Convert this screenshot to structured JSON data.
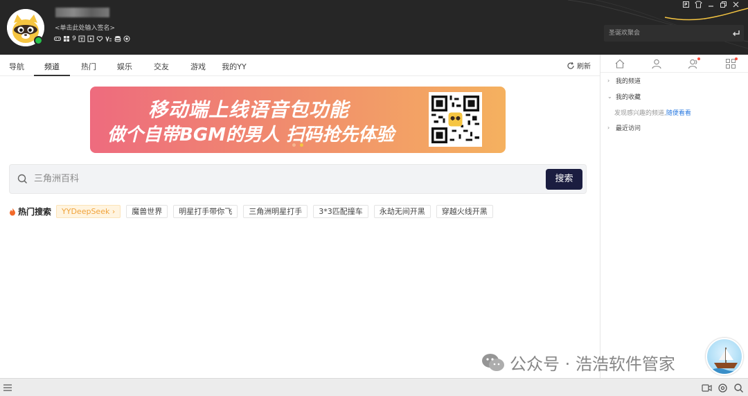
{
  "header": {
    "signature": "<单击此处输入签名>",
    "search_placeholder": "圣诞欢聚会",
    "badge_number": "9"
  },
  "tabs": [
    {
      "label": "导航"
    },
    {
      "label": "频道"
    },
    {
      "label": "热门"
    },
    {
      "label": "娱乐"
    },
    {
      "label": "交友"
    },
    {
      "label": "游戏"
    },
    {
      "label": "我的YY"
    }
  ],
  "active_tab": "频道",
  "refresh_label": "刷新",
  "banner": {
    "line1": "移动端上线语音包功能",
    "line2": "做个自带BGM的男人 扫码抢先体验"
  },
  "search": {
    "placeholder": "三角洲百科",
    "button_label": "搜索"
  },
  "hot_search": {
    "title": "热门搜索",
    "items": [
      "YYDeepSeek ›",
      "魔兽世界",
      "明星打手带你飞",
      "三角洲明星打手",
      "3*3匹配撞车",
      "永劫无间开黑",
      "穿越火线开黑"
    ]
  },
  "sidebar": {
    "my_channels": "我的频道",
    "my_favorites": "我的收藏",
    "hint_text": "发现感兴趣的频道,",
    "hint_link": "随便看看",
    "recent": "最近访问"
  },
  "watermark": {
    "text": "公众号 · 浩浩软件管家"
  },
  "colors": {
    "header_bg": "#262626",
    "search_button": "#1b1d40",
    "hot_first_chip": "#f0a33b",
    "link_blue": "#2f7de1",
    "online_green": "#27c24c"
  }
}
